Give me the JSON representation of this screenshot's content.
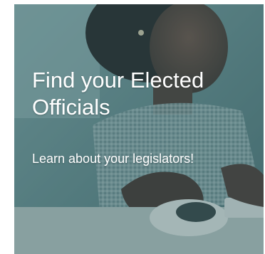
{
  "card": {
    "title": "Find your Elected Officials",
    "subtitle": "Learn about your legislators!",
    "photo_icon": "person-using-computer-mouse-photo",
    "overlay_color": "#3a6468"
  }
}
